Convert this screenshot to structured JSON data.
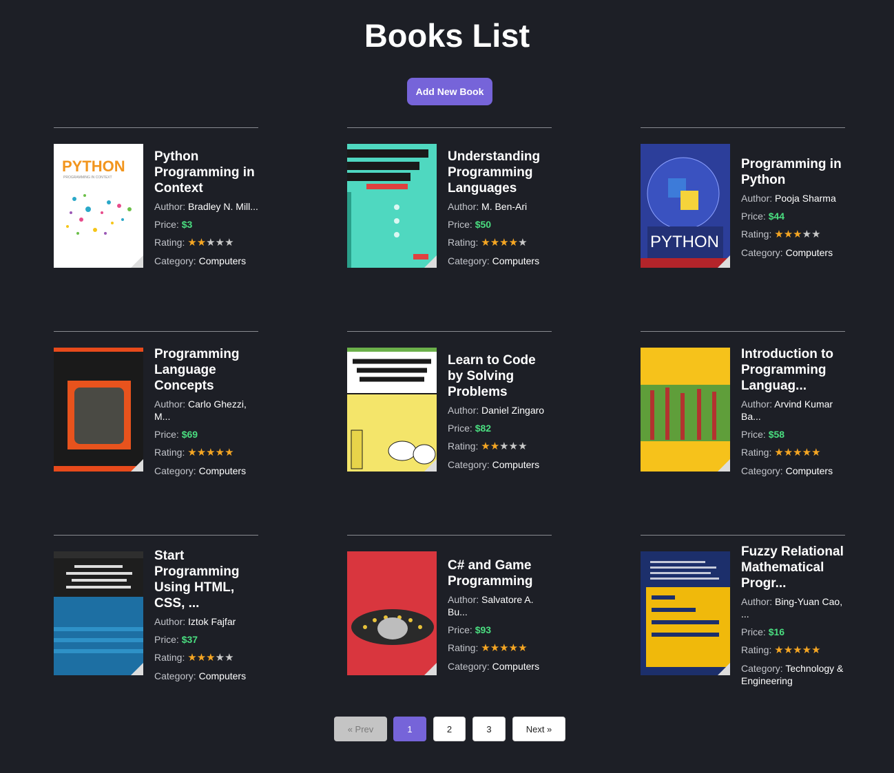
{
  "page": {
    "title": "Books List",
    "add_button": "Add New Book"
  },
  "labels": {
    "author": "Author: ",
    "price": "Price: ",
    "rating": "Rating: ",
    "category": "Category: "
  },
  "colors": {
    "background": "#1d1f26",
    "accent": "#7664d9",
    "price": "#4ade80",
    "star": "#f5a623"
  },
  "books": [
    {
      "title": "Python Programming in Context",
      "author": "Bradley N. Mill...",
      "price": "$3",
      "rating": 2,
      "category": "Computers"
    },
    {
      "title": "Understanding Programming Languages",
      "author": "M. Ben-Ari",
      "price": "$50",
      "rating": 4,
      "category": "Computers"
    },
    {
      "title": "Programming in Python",
      "author": "Pooja Sharma",
      "price": "$44",
      "rating": 3,
      "category": "Computers"
    },
    {
      "title": "Programming Language Concepts",
      "author": "Carlo Ghezzi, M...",
      "price": "$69",
      "rating": 5,
      "category": "Computers"
    },
    {
      "title": "Learn to Code by Solving Problems",
      "author": "Daniel Zingaro",
      "price": "$82",
      "rating": 2,
      "category": "Computers"
    },
    {
      "title": "Introduction to Programming Languag...",
      "author": "Arvind Kumar Ba...",
      "price": "$58",
      "rating": 5,
      "category": "Computers"
    },
    {
      "title": "Start Programming Using HTML, CSS, ...",
      "author": "Iztok Fajfar",
      "price": "$37",
      "rating": 3,
      "category": "Computers"
    },
    {
      "title": "C# and Game Programming",
      "author": "Salvatore A. Bu...",
      "price": "$93",
      "rating": 5,
      "category": "Computers"
    },
    {
      "title": "Fuzzy Relational Mathematical Progr...",
      "author": "Bing-Yuan Cao, ...",
      "price": "$16",
      "rating": 5,
      "category": "Technology & Engineering"
    }
  ],
  "pagination": {
    "prev": "« Prev",
    "pages": [
      "1",
      "2",
      "3"
    ],
    "next": "Next »",
    "current": "1"
  }
}
